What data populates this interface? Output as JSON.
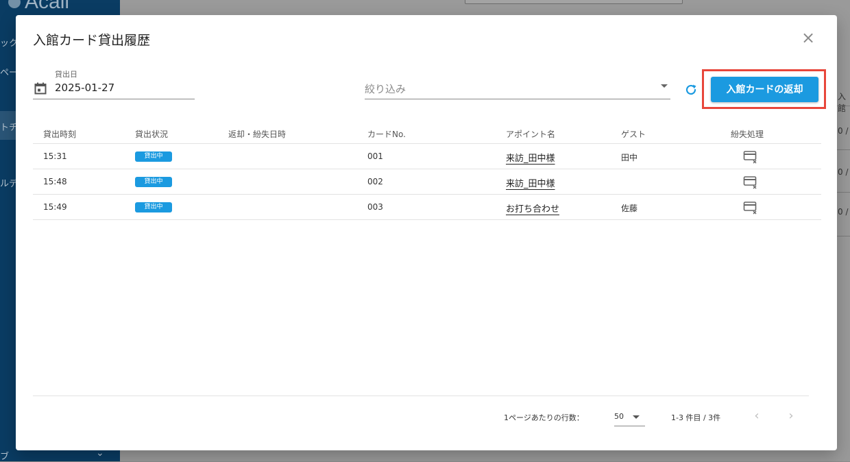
{
  "background": {
    "logo_text": "Acall",
    "side_texts": [
      "ック",
      "ペー",
      "トチ",
      "ルデ",
      "ブ"
    ],
    "right_col": [
      "入館",
      "0 /",
      "0 /",
      "0 /"
    ]
  },
  "modal": {
    "title": "入館カード貸出履歴",
    "close_icon": "close-icon"
  },
  "filters": {
    "date_label": "貸出日",
    "date_value": "2025-01-27",
    "filter_placeholder": "絞り込み",
    "return_button": "入館カードの返却"
  },
  "table": {
    "headers": [
      "貸出時刻",
      "貸出状況",
      "返却・紛失日時",
      "カードNo.",
      "アポイント名",
      "ゲスト",
      "紛失処理"
    ],
    "rows": [
      {
        "time": "15:31",
        "status": "貸出中",
        "returned": "",
        "card_no": "001",
        "appointment": "来訪_田中様",
        "guest": "田中"
      },
      {
        "time": "15:48",
        "status": "貸出中",
        "returned": "",
        "card_no": "002",
        "appointment": "来訪_田中様",
        "guest": ""
      },
      {
        "time": "15:49",
        "status": "貸出中",
        "returned": "",
        "card_no": "003",
        "appointment": "お打ち合わせ",
        "guest": "佐藤"
      }
    ]
  },
  "pagination": {
    "rows_per_page_label": "1ページあたりの行数：",
    "rows_per_page": "50",
    "range": "1-3 件目 / 3件",
    "prev": "‹",
    "next": "›"
  },
  "colors": {
    "accent": "#1b9ae0",
    "highlight": "#e8463a"
  }
}
